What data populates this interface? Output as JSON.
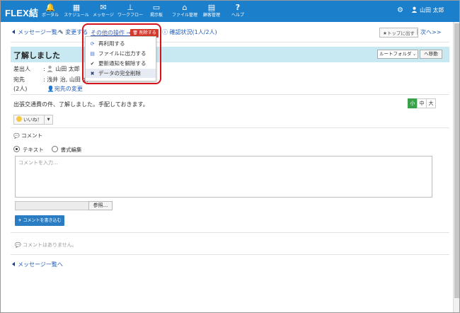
{
  "header": {
    "logo": "FLEX結",
    "nav": [
      {
        "label": "ポータル",
        "icon": "bell-icon",
        "glyph": "🔔"
      },
      {
        "label": "スケジュール",
        "icon": "calendar-icon",
        "glyph": "▦"
      },
      {
        "label": "メッセージ",
        "icon": "chat-icon",
        "glyph": "✉"
      },
      {
        "label": "ワークフロー",
        "icon": "stamp-icon",
        "glyph": "⊥"
      },
      {
        "label": "掲示板",
        "icon": "board-icon",
        "glyph": "▭"
      },
      {
        "label": "ファイル管理",
        "icon": "folder-icon",
        "glyph": "⌂"
      },
      {
        "label": "顧客管理",
        "icon": "book-icon",
        "glyph": "▤"
      },
      {
        "label": "ヘルプ",
        "icon": "help-icon",
        "glyph": "?"
      }
    ],
    "user_name": "山田 太郎"
  },
  "toolbar": {
    "back_link": "メッセージ一覧へ",
    "edit_link": "変更する",
    "other_ops": "その他の操作",
    "delete_button": "削除する",
    "confirm_status": "確認状況(1人/2人)",
    "pin_top": "トップに出す",
    "next": "次へ>>"
  },
  "message": {
    "title": "了解しました",
    "folder_select": "ルートフォルダ",
    "move_button": "へ移動",
    "sender_label": "差出人",
    "sender": "山田 太郎",
    "recipient_label": "宛先",
    "recipients": "浅井 治, 山田 太",
    "count": "(2人)",
    "change_recipients": "宛先の変更",
    "body": "出張交通費の件、了解しました。手配しておきます。",
    "text_sizes": [
      "小",
      "中",
      "大"
    ],
    "like_button": "いいね！"
  },
  "context_menu": {
    "items": [
      {
        "label": "再利用する",
        "icon": "refresh-icon"
      },
      {
        "label": "ファイルに出力する",
        "icon": "file-icon"
      },
      {
        "label": "更新通知を解除する",
        "icon": "check-icon"
      },
      {
        "label": "データの完全削除",
        "icon": "x-icon"
      }
    ]
  },
  "comment": {
    "heading": "コメント",
    "mode_text": "テキスト",
    "mode_rich": "書式編集",
    "placeholder": "コメントを入力...",
    "browse_button": "参照...",
    "post_button": "コメントを書き込む",
    "none_text": "コメントはありません。"
  },
  "footer": {
    "back_link": "メッセージ一覧へ"
  }
}
